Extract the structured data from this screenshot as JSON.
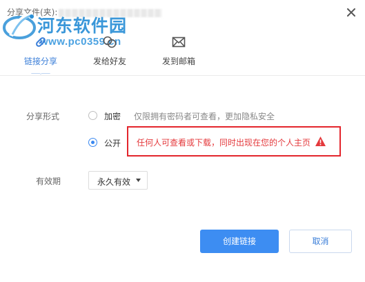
{
  "dialog": {
    "title": "分享文件(夹):"
  },
  "watermark": {
    "title": "河东软件园",
    "url": "www.pc0359.cn"
  },
  "tabs": [
    {
      "label": "链接分享",
      "icon": "link-icon",
      "active": true
    },
    {
      "label": "发给好友",
      "icon": "friends-icon",
      "active": false
    },
    {
      "label": "发到邮箱",
      "icon": "mail-icon",
      "active": false
    }
  ],
  "form": {
    "share_type_label": "分享形式",
    "options": {
      "private": {
        "label": "加密",
        "desc": "仅限拥有密码者可查看，更加隐私安全",
        "checked": false
      },
      "public": {
        "label": "公开",
        "desc": "任何人可查看或下载，同时出现在您的个人主页",
        "checked": true
      }
    },
    "validity_label": "有效期",
    "validity_value": "永久有效"
  },
  "buttons": {
    "create": "创建链接",
    "cancel": "取消"
  },
  "colors": {
    "accent": "#3d8df2",
    "warning": "#e4393c",
    "highlight_border": "#e3242b",
    "watermark": "#2a8fd6"
  }
}
